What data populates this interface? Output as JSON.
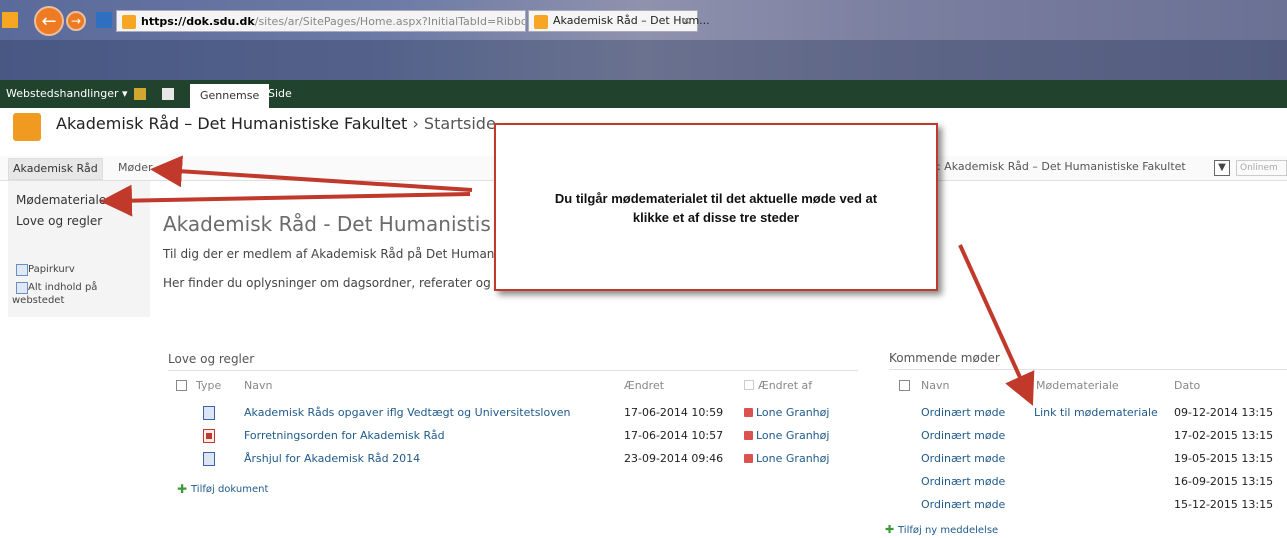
{
  "browser": {
    "url_domain": "https://dok.sdu.dk",
    "url_rest": "/sites/ar/SitePages/Home.aspx?InitialTabId=Ribbon%2E",
    "tab_title": "Akademisk Råd – Det Hum...",
    "tab_close": "×"
  },
  "ribbon": {
    "site_actions": "Webstedshandlinger",
    "tab_browse": "Gennemse",
    "tab_page": "Side"
  },
  "site": {
    "title": "Akademisk Råd – Det Humanistiske Fakultet",
    "breadcrumb_sep": "›",
    "breadcrumb_page": "Startside"
  },
  "topnav": {
    "home": "Akademisk Råd",
    "moder": "Møder",
    "search_scope": "d: Akademisk Råd – Det Humanistiske Fakultet",
    "search_placeholder": "Onlinem"
  },
  "quicklaunch": {
    "items": [
      "Mødemateriale",
      "Love og regler"
    ],
    "recycle": "Papirkurv",
    "all_content_1": "Alt indhold på",
    "all_content_2": "webstedet"
  },
  "main": {
    "heading": "Akademisk Råd - Det Humanistis",
    "intro_1": "Til dig der er medlem af Akademisk Råd på Det Human",
    "intro_2": "Her finder du oplysninger om dagsordner, referater og"
  },
  "love": {
    "title": "Love og regler",
    "headers": {
      "type": "Type",
      "name": "Navn",
      "modified": "Ændret",
      "modified_by": "Ændret af"
    },
    "rows": [
      {
        "icon": "word",
        "name": "Akademisk Råds opgaver iflg Vedtægt og Universitetsloven",
        "modified": "17-06-2014 10:59",
        "by": "Lone Granhøj"
      },
      {
        "icon": "pdf",
        "name": "Forretningsorden for Akademisk Råd",
        "modified": "17-06-2014 10:57",
        "by": "Lone Granhøj"
      },
      {
        "icon": "word",
        "name": "Årshjul for Akademisk Råd 2014",
        "modified": "23-09-2014 09:46",
        "by": "Lone Granhøj"
      }
    ],
    "add": "Tilføj dokument"
  },
  "moder": {
    "title": "Kommende møder",
    "headers": {
      "name": "Navn",
      "material": "Mødemateriale",
      "date": "Dato"
    },
    "rows": [
      {
        "name": "Ordinært møde",
        "material": "Link til mødemateriale",
        "date": "09-12-2014 13:15"
      },
      {
        "name": "Ordinært møde",
        "material": "",
        "date": "17-02-2015 13:15"
      },
      {
        "name": "Ordinært møde",
        "material": "",
        "date": "19-05-2015 13:15"
      },
      {
        "name": "Ordinært møde",
        "material": "",
        "date": "16-09-2015 13:15"
      },
      {
        "name": "Ordinært møde",
        "material": "",
        "date": "15-12-2015 13:15"
      }
    ],
    "add": "Tilføj ny meddelelse"
  },
  "callout": {
    "line1": "Du tilgår mødematerialet til det aktuelle møde ved at",
    "line2": "klikke et af disse tre steder"
  },
  "colors": {
    "ribbon": "#21432e",
    "accent": "#c0392b",
    "link": "#1f5a8a"
  }
}
